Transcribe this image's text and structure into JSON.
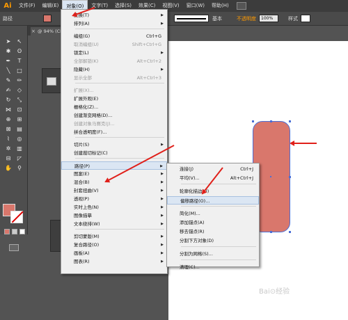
{
  "app": {
    "logo": "Ai"
  },
  "menubar": {
    "items": [
      "文件(F)",
      "编辑(E)",
      "对象(O)",
      "文字(T)",
      "选择(S)",
      "效果(C)",
      "视图(V)",
      "窗口(W)",
      "帮助(H)"
    ],
    "active_index": 2
  },
  "controlbar": {
    "object_label": "路径",
    "stroke_profile": "基本",
    "opacity_label": "不透明度",
    "opacity_value": "100%",
    "style_label": "样式"
  },
  "document_tab": {
    "close": "×",
    "label": "@ 94% (CMYK"
  },
  "object_menu": {
    "groups": [
      [
        {
          "label": "变换(T)",
          "submenu": true
        },
        {
          "label": "排列(A)",
          "submenu": true
        }
      ],
      [
        {
          "label": "编组(G)",
          "shortcut": "Ctrl+G"
        },
        {
          "label": "取消编组(U)",
          "shortcut": "Shift+Ctrl+G",
          "disabled": true
        },
        {
          "label": "锁定(L)",
          "submenu": true
        },
        {
          "label": "全部解锁(K)",
          "shortcut": "Alt+Ctrl+2",
          "disabled": true
        },
        {
          "label": "隐藏(H)",
          "submenu": true
        },
        {
          "label": "显示全部",
          "shortcut": "Alt+Ctrl+3",
          "disabled": true
        }
      ],
      [
        {
          "label": "扩展(X)...",
          "disabled": true
        },
        {
          "label": "扩展外观(E)"
        },
        {
          "label": "栅格化(Z)..."
        },
        {
          "label": "创建渐变网格(D)..."
        },
        {
          "label": "创建对象马赛克(J)...",
          "disabled": true
        },
        {
          "label": "拼合透明度(F)..."
        }
      ],
      [
        {
          "label": "切片(S)",
          "submenu": true
        },
        {
          "label": "创建裁切标记(C)"
        }
      ],
      [
        {
          "label": "路径(P)",
          "submenu": true,
          "highlighted": true
        },
        {
          "label": "图案(E)",
          "submenu": true
        },
        {
          "label": "混合(B)",
          "submenu": true
        },
        {
          "label": "封套扭曲(V)",
          "submenu": true
        },
        {
          "label": "透视(P)",
          "submenu": true
        },
        {
          "label": "实时上色(N)",
          "submenu": true
        },
        {
          "label": "图像描摹",
          "submenu": true
        },
        {
          "label": "文本绕排(W)",
          "submenu": true
        }
      ],
      [
        {
          "label": "剪切蒙版(M)",
          "submenu": true
        },
        {
          "label": "复合路径(O)",
          "submenu": true
        },
        {
          "label": "画板(A)",
          "submenu": true
        },
        {
          "label": "图表(R)",
          "submenu": true
        }
      ]
    ]
  },
  "path_submenu": {
    "groups": [
      [
        {
          "label": "连接(J)",
          "shortcut": "Ctrl+J"
        },
        {
          "label": "平均(V)...",
          "shortcut": "Alt+Ctrl+J"
        }
      ],
      [
        {
          "label": "轮廓化描边(U)"
        },
        {
          "label": "偏移路径(O)...",
          "highlighted": true
        }
      ],
      [
        {
          "label": "简化(M)..."
        },
        {
          "label": "添加锚点(A)"
        },
        {
          "label": "移去锚点(R)"
        },
        {
          "label": "分割下方对象(D)"
        }
      ],
      [
        {
          "label": "分割为网格(S)..."
        }
      ],
      [
        {
          "label": "清理(C)..."
        }
      ]
    ]
  },
  "artwork": {
    "fill_color": "#d9776c",
    "selection_color": "#4a6fd6"
  },
  "annotation_color": "#e0201a"
}
